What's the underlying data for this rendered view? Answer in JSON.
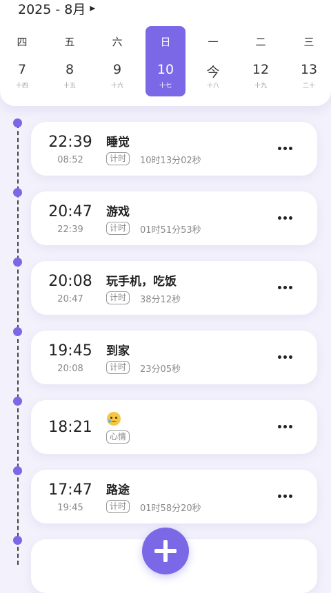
{
  "header": {
    "month_label": "2025 - 8月",
    "days": [
      {
        "weekday": "四",
        "day": "7",
        "lunar": "十四",
        "selected": false
      },
      {
        "weekday": "五",
        "day": "8",
        "lunar": "十五",
        "selected": false
      },
      {
        "weekday": "六",
        "day": "9",
        "lunar": "十六",
        "selected": false
      },
      {
        "weekday": "日",
        "day": "10",
        "lunar": "十七",
        "selected": true
      },
      {
        "weekday": "一",
        "day": "今",
        "lunar": "十八",
        "selected": false
      },
      {
        "weekday": "二",
        "day": "12",
        "lunar": "十九",
        "selected": false
      },
      {
        "weekday": "三",
        "day": "13",
        "lunar": "二十",
        "selected": false
      }
    ]
  },
  "entries": [
    {
      "start": "22:39",
      "end": "08:52",
      "title": "睡觉",
      "tag": "计时",
      "duration": "10时13分02秒"
    },
    {
      "start": "20:47",
      "end": "22:39",
      "title": "游戏",
      "tag": "计时",
      "duration": "01时51分53秒"
    },
    {
      "start": "20:08",
      "end": "20:47",
      "title": "玩手机，吃饭",
      "tag": "计时",
      "duration": "38分12秒"
    },
    {
      "start": "19:45",
      "end": "20:08",
      "title": "到家",
      "tag": "计时",
      "duration": "23分05秒"
    },
    {
      "start": "18:21",
      "end": "",
      "title": "",
      "icon": "crying-face-icon",
      "tag": "心情",
      "duration": ""
    },
    {
      "start": "17:47",
      "end": "19:45",
      "title": "路途",
      "tag": "计时",
      "duration": "01时58分20秒"
    }
  ],
  "colors": {
    "accent": "#7a68e6",
    "background": "#f3f1fb"
  }
}
